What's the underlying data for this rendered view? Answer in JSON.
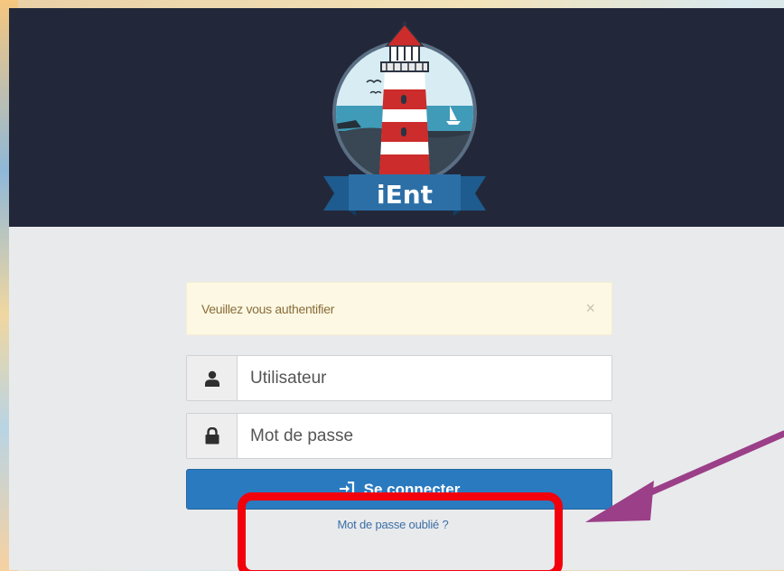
{
  "header": {
    "logo_text": "iEnt"
  },
  "alert": {
    "message": "Veuillez vous authentifier",
    "close_glyph": "×"
  },
  "form": {
    "username_placeholder": "Utilisateur",
    "password_placeholder": "Mot de passe",
    "login_label": "Se connecter",
    "forgot_link": "Mot de passe oublié ?"
  },
  "icons": {
    "username": "user-icon",
    "password": "lock-icon",
    "login": "sign-in-icon"
  },
  "annotation": {
    "highlight_color": "#f2000c",
    "arrow_color": "#9b3f88"
  },
  "colors": {
    "header_bg": "#22283a",
    "primary": "#2a7ac0",
    "alert_bg": "#fcf8e3",
    "alert_text": "#8a6d3b",
    "link": "#3b6fa6"
  }
}
